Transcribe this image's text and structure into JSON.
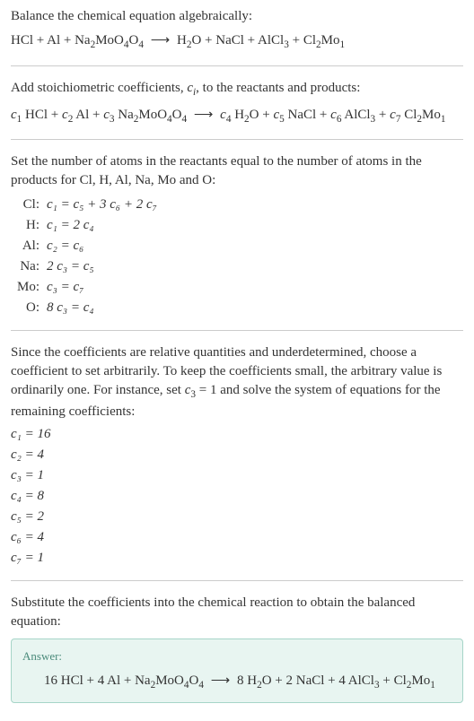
{
  "intro1": "Balance the chemical equation algebraically:",
  "eq1_lhs": "HCl + Al + Na",
  "eq1_lhs2": "MoO",
  "eq1_lhs3": "O",
  "eq1_rhs1": "H",
  "eq1_rhs2": "O + NaCl + AlCl",
  "eq1_rhs3": " + Cl",
  "eq1_rhs4": "Mo",
  "intro2a": "Add stoichiometric coefficients, ",
  "intro2b": ", to the reactants and products:",
  "ci": "c",
  "ci_sub": "i",
  "c1": "c",
  "n1": "1",
  "c2": "c",
  "n2": "2",
  "c3": "c",
  "n3": "3",
  "c4": "c",
  "n4": "4",
  "c5": "c",
  "n5": "5",
  "c6": "c",
  "n6": "6",
  "c7": "c",
  "n7": "7",
  "hcl": " HCl + ",
  "al": " Al + ",
  "na2": " Na",
  "moo4o4": "MoO",
  "o4b": "O",
  "h2o": " H",
  "oplus": "O + ",
  "nacl": " NaCl + ",
  "alcl3": " AlCl",
  "plus": " + ",
  "cl2mo1": " Cl",
  "mo": "Mo",
  "intro3": "Set the number of atoms in the reactants equal to the number of atoms in the products for Cl, H, Al, Na, Mo and O:",
  "atoms": [
    {
      "label": "Cl:",
      "eq": "c₁ = c₅ + 3 c₆ + 2 c₇"
    },
    {
      "label": "H:",
      "eq": "c₁ = 2 c₄"
    },
    {
      "label": "Al:",
      "eq": "c₂ = c₆"
    },
    {
      "label": "Na:",
      "eq": "2 c₃ = c₅"
    },
    {
      "label": "Mo:",
      "eq": "c₃ = c₇"
    },
    {
      "label": "O:",
      "eq": "8 c₃ = c₄"
    }
  ],
  "intro4a": "Since the coefficients are relative quantities and underdetermined, choose a coefficient to set arbitrarily. To keep the coefficients small, the arbitrary value is ordinarily one. For instance, set ",
  "intro4b": " = 1 and solve the system of equations for the remaining coefficients:",
  "coeffs": [
    "c₁ = 16",
    "c₂ = 4",
    "c₃ = 1",
    "c₄ = 8",
    "c₅ = 2",
    "c₆ = 4",
    "c₇ = 1"
  ],
  "intro5": "Substitute the coefficients into the chemical reaction to obtain the balanced equation:",
  "answer_label": "Answer:",
  "ans_lhs1": "16 HCl + 4 Al + Na",
  "ans_lhs2": "MoO",
  "ans_lhs3": "O",
  "ans_rhs1": "8 H",
  "ans_rhs2": "O + 2 NaCl + 4 AlCl",
  "ans_rhs3": " + Cl",
  "ans_rhs4": "Mo",
  "arrow": "⟶",
  "s2": "2",
  "s3": "3",
  "s4": "4",
  "s1": "1",
  "chart_data": {
    "type": "table",
    "title": "Chemical equation balancing",
    "atom_balance_equations": {
      "Cl": "c1 = c5 + 3*c6 + 2*c7",
      "H": "c1 = 2*c4",
      "Al": "c2 = c6",
      "Na": "2*c3 = c5",
      "Mo": "c3 = c7",
      "O": "8*c3 = c4"
    },
    "solved_coefficients": {
      "c1": 16,
      "c2": 4,
      "c3": 1,
      "c4": 8,
      "c5": 2,
      "c6": 4,
      "c7": 1
    },
    "balanced_equation": "16 HCl + 4 Al + Na2MoO4O4 -> 8 H2O + 2 NaCl + 4 AlCl3 + Cl2Mo1"
  }
}
